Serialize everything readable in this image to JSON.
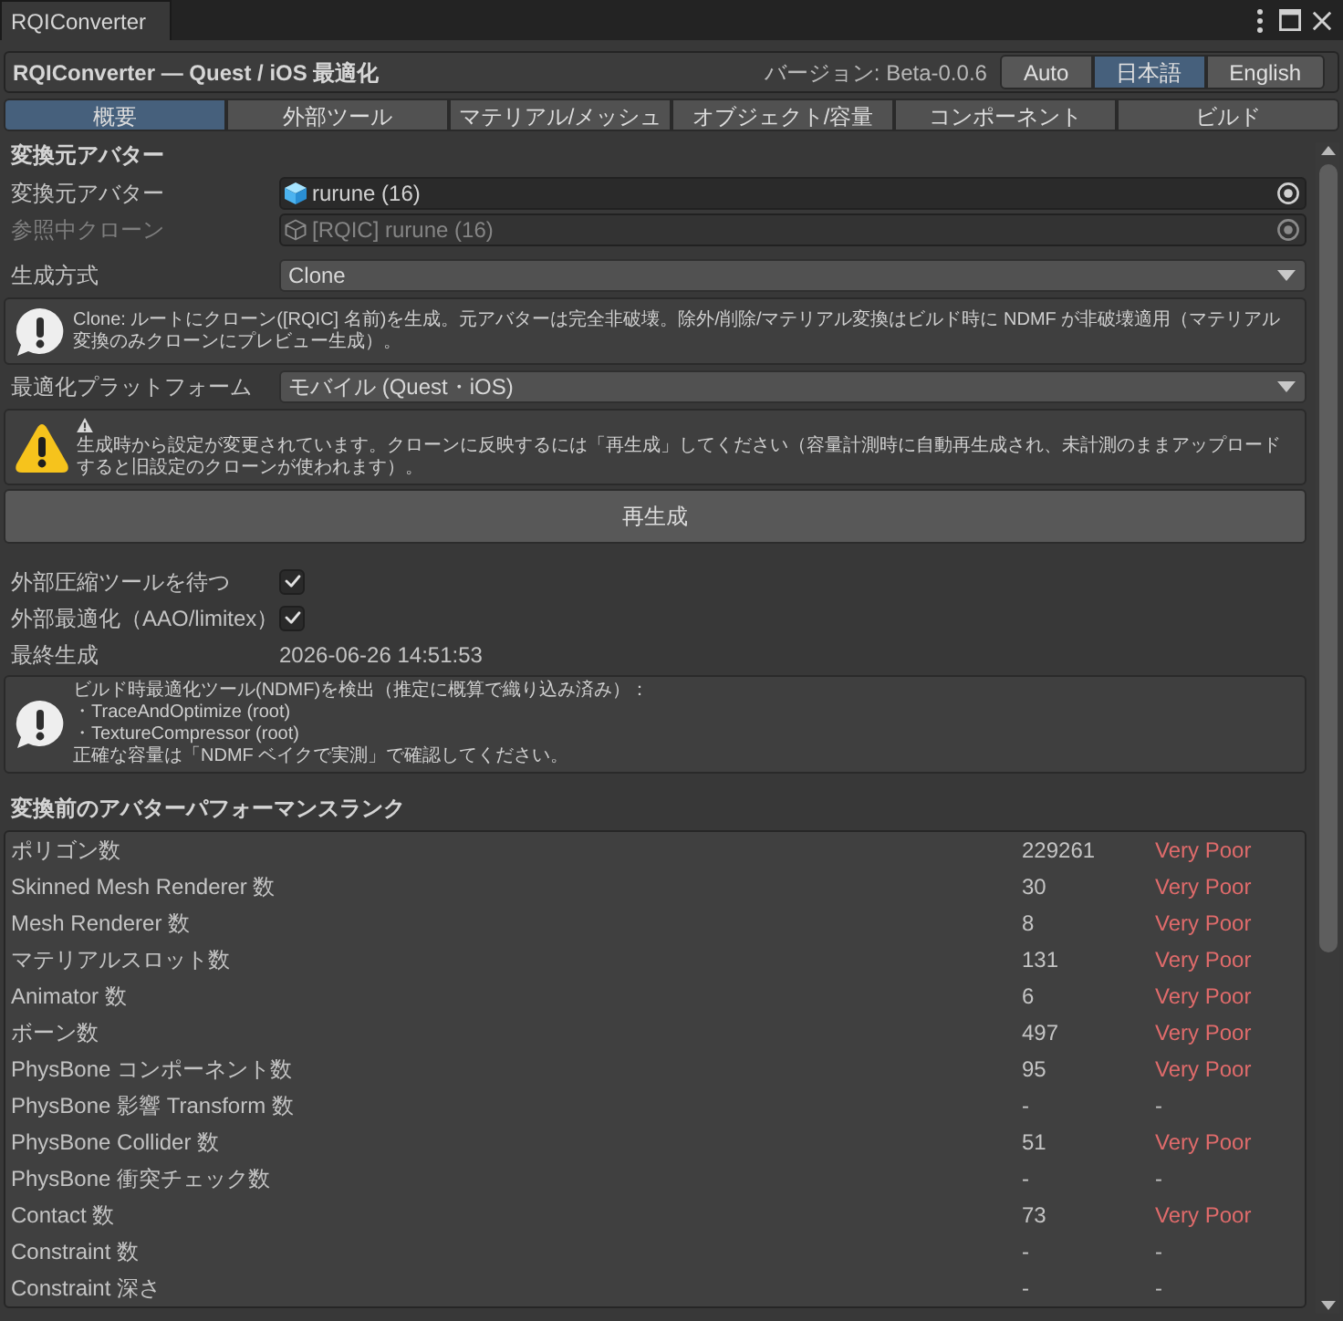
{
  "window": {
    "tab": "RQIConverter"
  },
  "header": {
    "title": "RQIConverter — Quest / iOS 最適化",
    "version": "バージョン: Beta-0.0.6",
    "languages": [
      {
        "label": "Auto",
        "selected": false
      },
      {
        "label": "日本語",
        "selected": true
      },
      {
        "label": "English",
        "selected": false
      }
    ]
  },
  "tabs": [
    {
      "label": "概要",
      "selected": true
    },
    {
      "label": "外部ツール",
      "selected": false
    },
    {
      "label": "マテリアル/メッシュ",
      "selected": false
    },
    {
      "label": "オブジェクト/容量",
      "selected": false
    },
    {
      "label": "コンポーネント",
      "selected": false
    },
    {
      "label": "ビルド",
      "selected": false
    }
  ],
  "content": [
    {
      "kind": "heading",
      "text": "変換元アバター"
    },
    {
      "kind": "object",
      "label": "変換元アバター",
      "value": "rurune (16)",
      "disabled": false
    },
    {
      "kind": "object",
      "label": "参照中クローン",
      "value": "[RQIC] rurune (16)",
      "disabled": true
    },
    {
      "kind": "dropdown",
      "label": "生成方式",
      "value": "Clone"
    },
    {
      "kind": "info",
      "lines": [
        "Clone: ルートにクローン([RQIC] 名前)を生成。元アバターは完全非破壊。除外/削除/マテリアル変換はビルド時に NDMF が非破壊適用（マテリアル変換のみクローンにプレビュー生成）。"
      ]
    },
    {
      "kind": "dropdown",
      "label": "最適化プラットフォーム",
      "value": "モバイル (Quest・iOS)"
    },
    {
      "kind": "warning",
      "lines": [
        "生成時から設定が変更されています。クローンに反映するには「再生成」してください（容量計測時に自動再生成され、未計測のままアップロードすると旧設定のクローンが使われます）。"
      ]
    },
    {
      "kind": "button",
      "label": "再生成"
    },
    {
      "kind": "toggle",
      "label": "外部圧縮ツールを待つ",
      "checked": true
    },
    {
      "kind": "toggle",
      "label": "外部最適化（AAO/limitex）",
      "checked": true
    },
    {
      "kind": "readout",
      "label": "最終生成",
      "value": "2026-06-26 14:51:53"
    },
    {
      "kind": "info",
      "lines": [
        "ビルド時最適化ツール(NDMF)を検出（推定に概算で織り込み済み）：",
        "・TraceAndOptimize (root)",
        "・TextureCompressor (root)",
        "正確な容量は「NDMF ベイクで実測」で確認してください。"
      ]
    },
    {
      "kind": "heading",
      "text": "変換前のアバターパフォーマンスランク"
    },
    {
      "kind": "table",
      "rows": [
        {
          "name": "ポリゴン数",
          "value": "229261",
          "rank": "Very Poor",
          "color": "#e06b6b"
        },
        {
          "name": "Skinned Mesh Renderer 数",
          "value": "30",
          "rank": "Very Poor",
          "color": "#e06b6b"
        },
        {
          "name": "Mesh Renderer 数",
          "value": "8",
          "rank": "Very Poor",
          "color": "#e06b6b"
        },
        {
          "name": "マテリアルスロット数",
          "value": "131",
          "rank": "Very Poor",
          "color": "#e06b6b"
        },
        {
          "name": "Animator 数",
          "value": "6",
          "rank": "Very Poor",
          "color": "#e06b6b"
        },
        {
          "name": "ボーン数",
          "value": "497",
          "rank": "Very Poor",
          "color": "#e06b6b"
        },
        {
          "name": "PhysBone コンポーネント数",
          "value": "95",
          "rank": "Very Poor",
          "color": "#e06b6b"
        },
        {
          "name": "PhysBone 影響 Transform 数",
          "value": "-",
          "rank": "-",
          "color": "#bdbdbd"
        },
        {
          "name": "PhysBone Collider 数",
          "value": "51",
          "rank": "Very Poor",
          "color": "#e06b6b"
        },
        {
          "name": "PhysBone 衝突チェック数",
          "value": "-",
          "rank": "-",
          "color": "#bdbdbd"
        },
        {
          "name": "Contact 数",
          "value": "73",
          "rank": "Very Poor",
          "color": "#e06b6b"
        },
        {
          "name": "Constraint 数",
          "value": "-",
          "rank": "-",
          "color": "#bdbdbd"
        },
        {
          "name": "Constraint 深さ",
          "value": "-",
          "rank": "-",
          "color": "#bdbdbd"
        }
      ]
    }
  ]
}
